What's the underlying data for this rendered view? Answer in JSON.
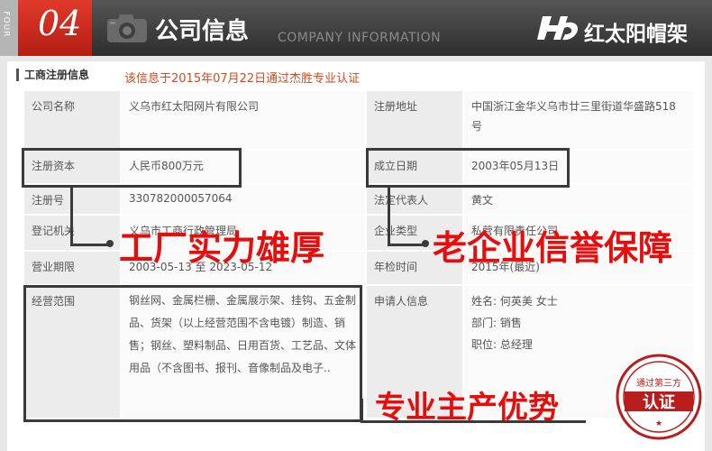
{
  "header": {
    "side_text": "FOUR",
    "number": "04",
    "title": "公司信息",
    "subtitle": "COMPANY  INFORMATION",
    "brand": "红太阳帽架",
    "camera_icon": "camera-icon",
    "logo_icon": "hd-logo-icon"
  },
  "section": {
    "title": "工商注册信息",
    "certified": "该信息于2015年07月22日通过杰胜专业认证"
  },
  "rows": [
    {
      "l1": "公司名称",
      "v1": "义乌市红太阳网片有限公司",
      "l2": "注册地址",
      "v2": "中国浙江金华义乌市廿三里街道华盛路518 号"
    },
    {
      "l1": "注册资本",
      "v1": "人民币800万元",
      "l2": "成立日期",
      "v2": "2003年05月13日"
    },
    {
      "l1": "注册号",
      "v1": "330782000057064",
      "l2": "法定代表人",
      "v2": "黄文"
    },
    {
      "l1": "登记机关",
      "v1": "义乌市工商行政管理局",
      "l2": "企业类型",
      "v2": "私营有限责任公司"
    },
    {
      "l1": "营业期限",
      "v1": "2003-05-13 至 2023-05-12",
      "l2": "年检时间",
      "v2": "2015年(最近)"
    },
    {
      "l1": "经营范围",
      "v1": "钢丝网、金属栏栅、金属展示架、挂钩、五金制品、货架（以上经营范围不含电镀）制造、销售；钢丝、塑料制品、日用百货、工艺品、文体用品（不含图书、报刊、音像制品及电子..",
      "l2": "申请人信息",
      "v2": ""
    }
  ],
  "applicant": {
    "name_label": "姓名:",
    "name": "何英美  女士",
    "dept_label": "部门:",
    "dept": "销售",
    "pos_label": "职位:",
    "pos": "总经理"
  },
  "annotations": {
    "factory": "工厂实力雄厚",
    "old_company": "老企业信誉保障",
    "specialty": "专业主产优势"
  },
  "stamp": {
    "top": "通过第三方",
    "main": "认证"
  },
  "colors": {
    "accent_red": "#e60d0d",
    "header_bg": "#3a3a3a",
    "number_bg": "#c9261a",
    "cert_text": "#d24a1e"
  }
}
